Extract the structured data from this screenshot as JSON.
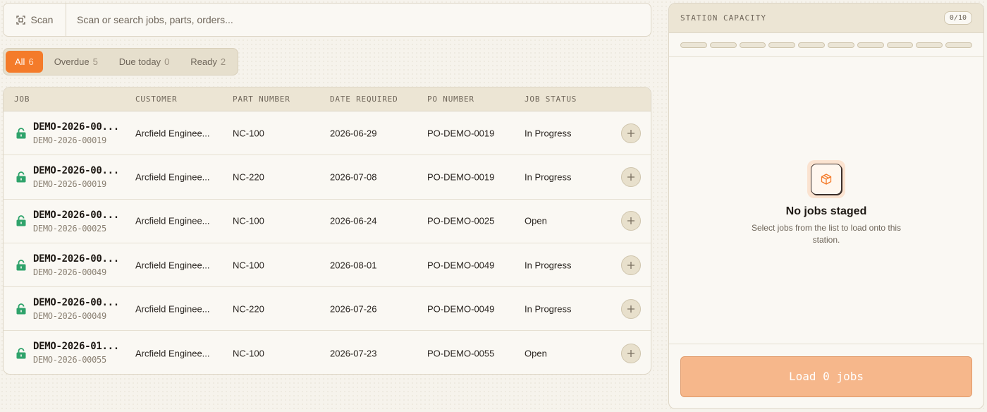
{
  "search": {
    "scan_label": "Scan",
    "placeholder": "Scan or search jobs, parts, orders..."
  },
  "tabs": [
    {
      "label": "All",
      "count": "6",
      "active": true
    },
    {
      "label": "Overdue",
      "count": "5",
      "active": false
    },
    {
      "label": "Due today",
      "count": "0",
      "active": false
    },
    {
      "label": "Ready",
      "count": "2",
      "active": false
    }
  ],
  "table": {
    "headers": {
      "job": "JOB",
      "customer": "CUSTOMER",
      "part_number": "PART NUMBER",
      "date_required": "DATE REQUIRED",
      "po_number": "PO NUMBER",
      "job_status": "JOB STATUS"
    },
    "rows": [
      {
        "job": "DEMO-2026-00...",
        "job_sub": "DEMO-2026-00019",
        "customer": "Arcfield Enginee...",
        "part": "NC-100",
        "date": "2026-06-29",
        "po": "PO-DEMO-0019",
        "status": "In Progress"
      },
      {
        "job": "DEMO-2026-00...",
        "job_sub": "DEMO-2026-00019",
        "customer": "Arcfield Enginee...",
        "part": "NC-220",
        "date": "2026-07-08",
        "po": "PO-DEMO-0019",
        "status": "In Progress"
      },
      {
        "job": "DEMO-2026-00...",
        "job_sub": "DEMO-2026-00025",
        "customer": "Arcfield Enginee...",
        "part": "NC-100",
        "date": "2026-06-24",
        "po": "PO-DEMO-0025",
        "status": "Open"
      },
      {
        "job": "DEMO-2026-00...",
        "job_sub": "DEMO-2026-00049",
        "customer": "Arcfield Enginee...",
        "part": "NC-100",
        "date": "2026-08-01",
        "po": "PO-DEMO-0049",
        "status": "In Progress"
      },
      {
        "job": "DEMO-2026-00...",
        "job_sub": "DEMO-2026-00049",
        "customer": "Arcfield Enginee...",
        "part": "NC-220",
        "date": "2026-07-26",
        "po": "PO-DEMO-0049",
        "status": "In Progress"
      },
      {
        "job": "DEMO-2026-01...",
        "job_sub": "DEMO-2026-00055",
        "customer": "Arcfield Enginee...",
        "part": "NC-100",
        "date": "2026-07-23",
        "po": "PO-DEMO-0055",
        "status": "Open"
      }
    ],
    "row_icon": "lock-open-icon",
    "row_action_icon": "plus-icon"
  },
  "station": {
    "title": "STATION CAPACITY",
    "capacity": "0/10",
    "slots_filled": 0,
    "slots_total": 10,
    "empty_icon": "package-icon",
    "empty_title": "No jobs staged",
    "empty_desc": "Select jobs from the list to load onto this station.",
    "load_label": "Load 0 jobs"
  },
  "colors": {
    "accent": "#f47b2a",
    "accent_disabled": "#f6b78b",
    "lock_icon": "#2fa36b",
    "background": "#f6f3ec"
  }
}
